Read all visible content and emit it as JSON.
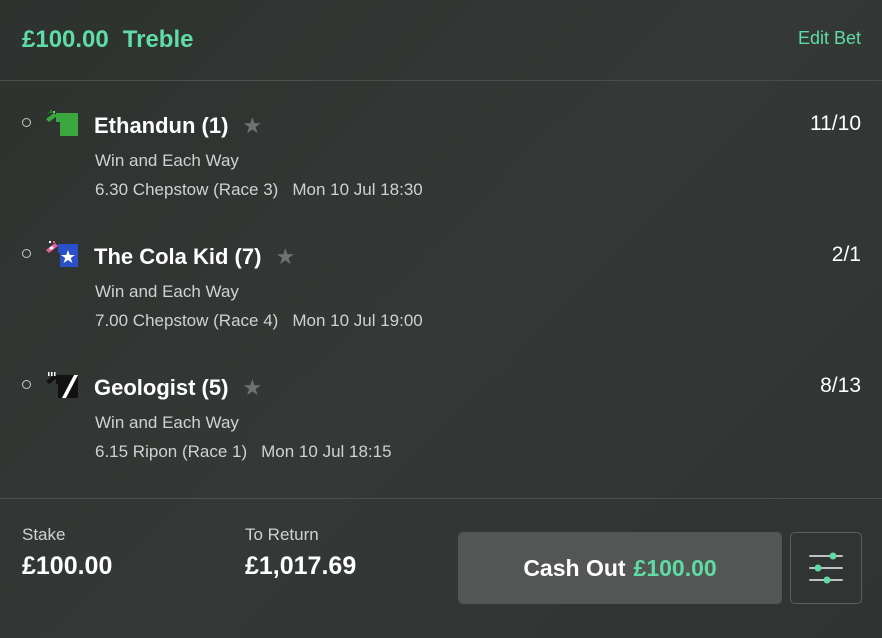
{
  "header": {
    "stake_amount": "£100.00",
    "bet_type": "Treble",
    "edit_label": "Edit Bet"
  },
  "selections": [
    {
      "runner": "Ethandun (1)",
      "odds": "11/10",
      "market": "Win and Each Way",
      "race": "6.30 Chepstow (Race 3)",
      "datetime": "Mon 10 Jul 18:30",
      "silk_icon": "silk-green-icon"
    },
    {
      "runner": "The Cola Kid (7)",
      "odds": "2/1",
      "market": "Win and Each Way",
      "race": "7.00 Chepstow (Race 4)",
      "datetime": "Mon 10 Jul 19:00",
      "silk_icon": "silk-blue-star-icon"
    },
    {
      "runner": "Geologist (5)",
      "odds": "8/13",
      "market": "Win and Each Way",
      "race": "6.15 Ripon (Race 1)",
      "datetime": "Mon 10 Jul 18:15",
      "silk_icon": "silk-black-sash-icon"
    }
  ],
  "footer": {
    "stake_label": "Stake",
    "stake_value": "£100.00",
    "return_label": "To Return",
    "return_value": "£1,017.69",
    "cashout_label": "Cash Out",
    "cashout_amount": "£100.00"
  },
  "colors": {
    "accent": "#5fdca3",
    "background": "#323634",
    "button": "#535654"
  }
}
